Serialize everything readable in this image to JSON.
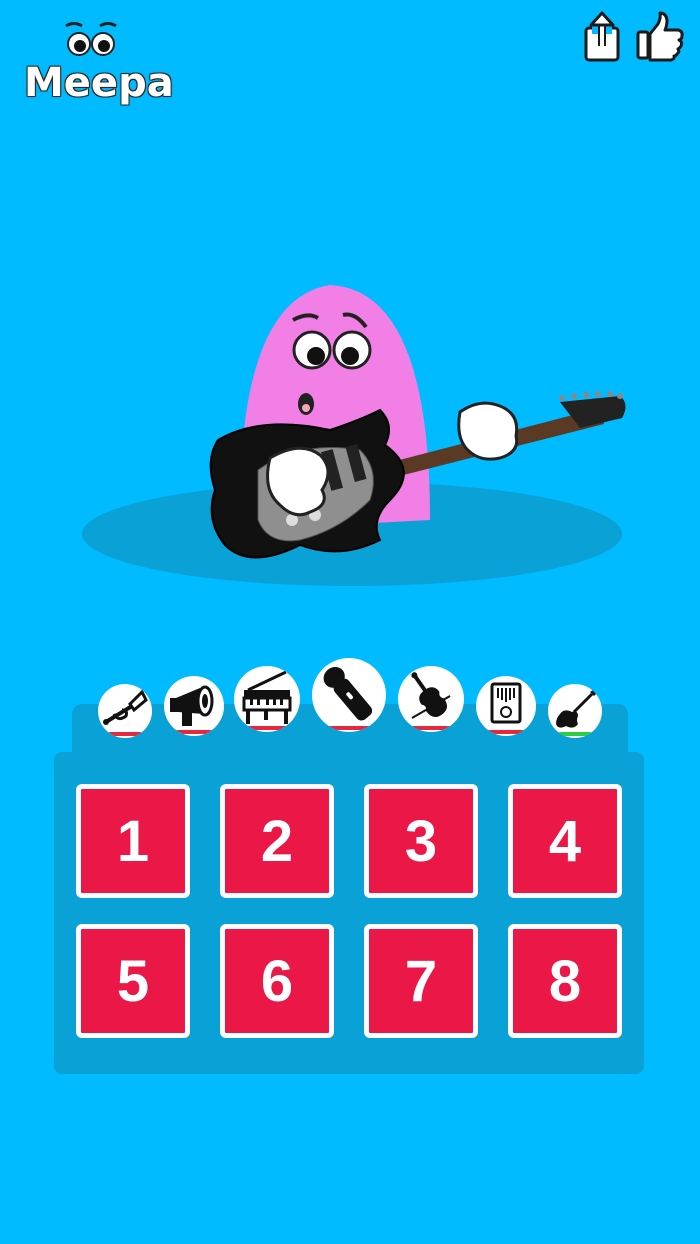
{
  "app": {
    "logo_text": "Meepa"
  },
  "header": {
    "share_icon": "share-icon",
    "like_icon": "thumbs-up-icon"
  },
  "character": {
    "body_color": "#F27FE6",
    "instrument": "electric-guitar"
  },
  "instruments": [
    {
      "name": "trumpet",
      "icon": "trumpet-icon",
      "selected": false
    },
    {
      "name": "megaphone",
      "icon": "megaphone-icon",
      "selected": false
    },
    {
      "name": "piano",
      "icon": "piano-icon",
      "selected": false
    },
    {
      "name": "microphone",
      "icon": "microphone-icon",
      "selected": false
    },
    {
      "name": "violin",
      "icon": "violin-icon",
      "selected": false
    },
    {
      "name": "kalimba",
      "icon": "kalimba-icon",
      "selected": false
    },
    {
      "name": "electric-guitar",
      "icon": "electric-guitar-icon",
      "selected": true
    }
  ],
  "pads": [
    {
      "label": "1"
    },
    {
      "label": "2"
    },
    {
      "label": "3"
    },
    {
      "label": "4"
    },
    {
      "label": "5"
    },
    {
      "label": "6"
    },
    {
      "label": "7"
    },
    {
      "label": "8"
    }
  ],
  "colors": {
    "background": "#00BBFF",
    "panel": "#0AA1D6",
    "pad": "#EB1746",
    "tab_underline_default": "#E8263C",
    "tab_underline_selected": "#2ECC40"
  }
}
